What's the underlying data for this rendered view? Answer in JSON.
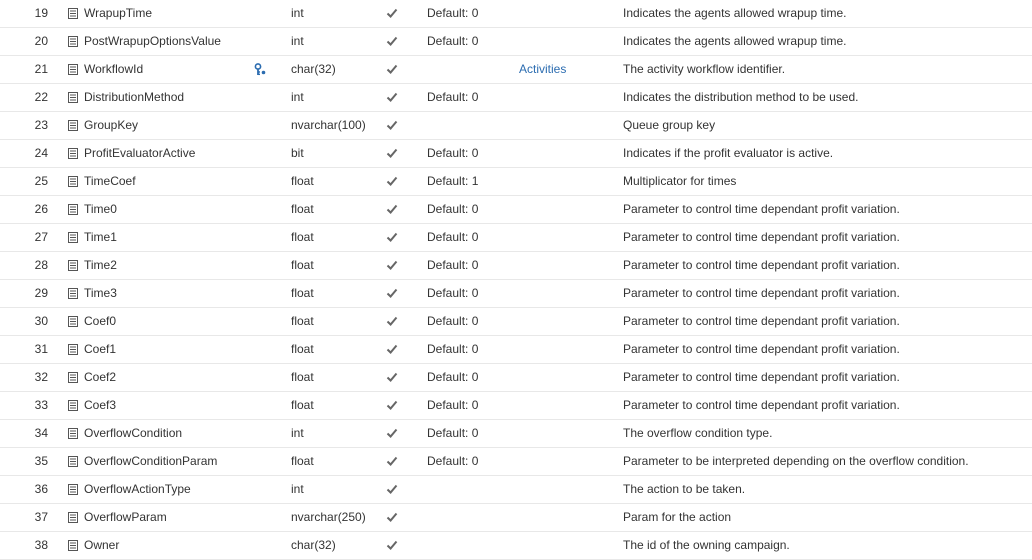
{
  "icons": {
    "column": "column-list-icon",
    "key": "foreign-key-icon",
    "nullable": "checkmark-icon"
  },
  "colors": {
    "link": "#2b6cb0",
    "key_icon": "#2b6cb0",
    "check": "#666666",
    "row_border": "#e8e8e8"
  },
  "rows": [
    {
      "num": "19",
      "name": "WrapupTime",
      "type": "int",
      "default": "Default: 0",
      "relation": "",
      "desc": "Indicates the agents allowed wrapup time.",
      "key": false
    },
    {
      "num": "20",
      "name": "PostWrapupOptionsValue",
      "type": "int",
      "default": "Default: 0",
      "relation": "",
      "desc": "Indicates the agents allowed wrapup time.",
      "key": false
    },
    {
      "num": "21",
      "name": "WorkflowId",
      "type": "char(32)",
      "default": "",
      "relation": "Activities",
      "desc": "The activity workflow identifier.",
      "key": true
    },
    {
      "num": "22",
      "name": "DistributionMethod",
      "type": "int",
      "default": "Default: 0",
      "relation": "",
      "desc": "Indicates the distribution method to be used.",
      "key": false
    },
    {
      "num": "23",
      "name": "GroupKey",
      "type": "nvarchar(100)",
      "default": "",
      "relation": "",
      "desc": "Queue group key",
      "key": false
    },
    {
      "num": "24",
      "name": "ProfitEvaluatorActive",
      "type": "bit",
      "default": "Default: 0",
      "relation": "",
      "desc": "Indicates if the profit evaluator is active.",
      "key": false
    },
    {
      "num": "25",
      "name": "TimeCoef",
      "type": "float",
      "default": "Default: 1",
      "relation": "",
      "desc": "Multiplicator for times",
      "key": false
    },
    {
      "num": "26",
      "name": "Time0",
      "type": "float",
      "default": "Default: 0",
      "relation": "",
      "desc": "Parameter to control time dependant profit variation.",
      "key": false
    },
    {
      "num": "27",
      "name": "Time1",
      "type": "float",
      "default": "Default: 0",
      "relation": "",
      "desc": "Parameter to control time dependant profit variation.",
      "key": false
    },
    {
      "num": "28",
      "name": "Time2",
      "type": "float",
      "default": "Default: 0",
      "relation": "",
      "desc": "Parameter to control time dependant profit variation.",
      "key": false
    },
    {
      "num": "29",
      "name": "Time3",
      "type": "float",
      "default": "Default: 0",
      "relation": "",
      "desc": "Parameter to control time dependant profit variation.",
      "key": false
    },
    {
      "num": "30",
      "name": "Coef0",
      "type": "float",
      "default": "Default: 0",
      "relation": "",
      "desc": "Parameter to control time dependant profit variation.",
      "key": false
    },
    {
      "num": "31",
      "name": "Coef1",
      "type": "float",
      "default": "Default: 0",
      "relation": "",
      "desc": "Parameter to control time dependant profit variation.",
      "key": false
    },
    {
      "num": "32",
      "name": "Coef2",
      "type": "float",
      "default": "Default: 0",
      "relation": "",
      "desc": "Parameter to control time dependant profit variation.",
      "key": false
    },
    {
      "num": "33",
      "name": "Coef3",
      "type": "float",
      "default": "Default: 0",
      "relation": "",
      "desc": "Parameter to control time dependant profit variation.",
      "key": false
    },
    {
      "num": "34",
      "name": "OverflowCondition",
      "type": "int",
      "default": "Default: 0",
      "relation": "",
      "desc": "The overflow condition type.",
      "key": false
    },
    {
      "num": "35",
      "name": "OverflowConditionParam",
      "type": "float",
      "default": "Default: 0",
      "relation": "",
      "desc": "Parameter to be interpreted depending on the overflow condition.",
      "key": false
    },
    {
      "num": "36",
      "name": "OverflowActionType",
      "type": "int",
      "default": "",
      "relation": "",
      "desc": "The action to be taken.",
      "key": false
    },
    {
      "num": "37",
      "name": "OverflowParam",
      "type": "nvarchar(250)",
      "default": "",
      "relation": "",
      "desc": "Param for the action",
      "key": false
    },
    {
      "num": "38",
      "name": "Owner",
      "type": "char(32)",
      "default": "",
      "relation": "",
      "desc": "The id of the owning campaign.",
      "key": false
    }
  ]
}
